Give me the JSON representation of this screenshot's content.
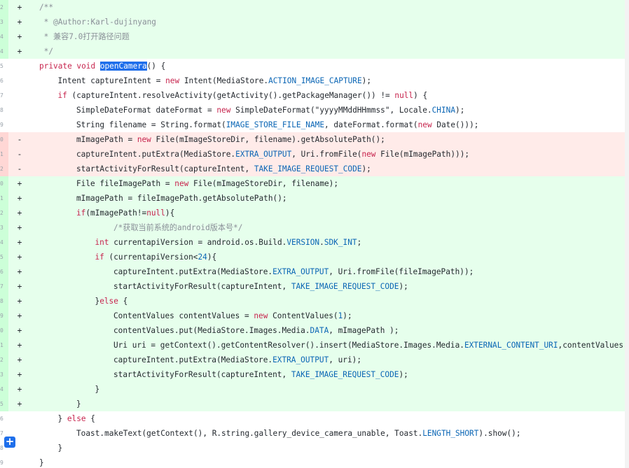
{
  "diff": {
    "add_comment_icon": "plus-icon",
    "colors": {
      "added_background": "#e6ffec",
      "removed_background": "#ffebe9",
      "keyword": "#c7254e",
      "constant": "#0b66b5",
      "comment": "#8a8f98",
      "selection": "#1f6feb"
    },
    "lines": [
      {
        "type": "add",
        "marker": "+",
        "line_no": "2",
        "indent": 0,
        "tokens": [
          {
            "t": "/**",
            "c": "com"
          }
        ]
      },
      {
        "type": "add",
        "marker": "+",
        "line_no": "3",
        "indent": 0,
        "tokens": [
          {
            "t": " * @Author:Karl-dujinyang",
            "c": "com"
          }
        ]
      },
      {
        "type": "add",
        "marker": "+",
        "line_no": "4",
        "indent": 0,
        "tokens": [
          {
            "t": " * 兼容7.0打开路径问题",
            "c": "com"
          }
        ]
      },
      {
        "type": "add",
        "marker": "+",
        "line_no": "4",
        "indent": 0,
        "tokens": [
          {
            "t": " */",
            "c": "com"
          }
        ]
      },
      {
        "type": "ctx",
        "marker": "",
        "line_no": "5",
        "indent": 0,
        "tokens": [
          {
            "t": "private void ",
            "c": "kw"
          },
          {
            "t": "openCamera",
            "c": "hl"
          },
          {
            "t": "() {",
            "c": "plain"
          }
        ]
      },
      {
        "type": "ctx",
        "marker": "",
        "line_no": "6",
        "indent": 1,
        "tokens": [
          {
            "t": "Intent captureIntent = ",
            "c": "plain"
          },
          {
            "t": "new",
            "c": "kw"
          },
          {
            "t": " Intent(MediaStore.",
            "c": "plain"
          },
          {
            "t": "ACTION_IMAGE_CAPTURE",
            "c": "const"
          },
          {
            "t": ");",
            "c": "plain"
          }
        ]
      },
      {
        "type": "ctx",
        "marker": "",
        "line_no": "7",
        "indent": 1,
        "tokens": [
          {
            "t": "if",
            "c": "kw"
          },
          {
            "t": " (captureIntent.resolveActivity(getActivity().getPackageManager()) != ",
            "c": "plain"
          },
          {
            "t": "null",
            "c": "kw"
          },
          {
            "t": ") {",
            "c": "plain"
          }
        ]
      },
      {
        "type": "ctx",
        "marker": "",
        "line_no": "8",
        "indent": 2,
        "tokens": [
          {
            "t": "SimpleDateFormat dateFormat = ",
            "c": "plain"
          },
          {
            "t": "new",
            "c": "kw"
          },
          {
            "t": " SimpleDateFormat(\"yyyyMMddHHmmss\", Locale.",
            "c": "plain"
          },
          {
            "t": "CHINA",
            "c": "const"
          },
          {
            "t": ");",
            "c": "plain"
          }
        ]
      },
      {
        "type": "ctx",
        "marker": "",
        "line_no": "9",
        "indent": 2,
        "tokens": [
          {
            "t": "String filename = String.format(",
            "c": "plain"
          },
          {
            "t": "IMAGE_STORE_FILE_NAME",
            "c": "const"
          },
          {
            "t": ", dateFormat.format(",
            "c": "plain"
          },
          {
            "t": "new",
            "c": "kw"
          },
          {
            "t": " Date()));",
            "c": "plain"
          }
        ]
      },
      {
        "type": "del",
        "marker": "-",
        "line_no": "0",
        "indent": 2,
        "tokens": [
          {
            "t": "mImagePath = ",
            "c": "plain"
          },
          {
            "t": "new",
            "c": "kw"
          },
          {
            "t": " File(mImageStoreDir, filename).getAbsolutePath();",
            "c": "plain"
          }
        ]
      },
      {
        "type": "del",
        "marker": "-",
        "line_no": "1",
        "indent": 2,
        "tokens": [
          {
            "t": "captureIntent.putExtra(MediaStore.",
            "c": "plain"
          },
          {
            "t": "EXTRA_OUTPUT",
            "c": "const"
          },
          {
            "t": ", Uri.fromFile(",
            "c": "plain"
          },
          {
            "t": "new",
            "c": "kw"
          },
          {
            "t": " File(mImagePath)));",
            "c": "plain"
          }
        ]
      },
      {
        "type": "del",
        "marker": "-",
        "line_no": "2",
        "indent": 2,
        "tokens": [
          {
            "t": "startActivityForResult(captureIntent, ",
            "c": "plain"
          },
          {
            "t": "TAKE_IMAGE_REQUEST_CODE",
            "c": "const"
          },
          {
            "t": ");",
            "c": "plain"
          }
        ]
      },
      {
        "type": "add",
        "marker": "+",
        "line_no": "0",
        "indent": 2,
        "tokens": [
          {
            "t": "File fileImagePath = ",
            "c": "plain"
          },
          {
            "t": "new",
            "c": "kw"
          },
          {
            "t": " File(mImageStoreDir, filename);",
            "c": "plain"
          }
        ]
      },
      {
        "type": "add",
        "marker": "+",
        "line_no": "1",
        "indent": 2,
        "tokens": [
          {
            "t": "mImagePath = fileImagePath.getAbsolutePath();",
            "c": "plain"
          }
        ]
      },
      {
        "type": "add",
        "marker": "+",
        "line_no": "2",
        "indent": 2,
        "tokens": [
          {
            "t": "if",
            "c": "kw"
          },
          {
            "t": "(mImagePath!=",
            "c": "plain"
          },
          {
            "t": "null",
            "c": "kw"
          },
          {
            "t": "){",
            "c": "plain"
          }
        ]
      },
      {
        "type": "add",
        "marker": "+",
        "line_no": "3",
        "indent": 4,
        "tokens": [
          {
            "t": "/*获取当前系统的android版本号*/",
            "c": "com"
          }
        ]
      },
      {
        "type": "add",
        "marker": "+",
        "line_no": "4",
        "indent": 3,
        "tokens": [
          {
            "t": "int",
            "c": "kw"
          },
          {
            "t": " currentapiVersion = android.os.Build.",
            "c": "plain"
          },
          {
            "t": "VERSION",
            "c": "const"
          },
          {
            "t": ".",
            "c": "plain"
          },
          {
            "t": "SDK_INT",
            "c": "const"
          },
          {
            "t": ";",
            "c": "plain"
          }
        ]
      },
      {
        "type": "add",
        "marker": "+",
        "line_no": "5",
        "indent": 3,
        "tokens": [
          {
            "t": "if",
            "c": "kw"
          },
          {
            "t": " (currentapiVersion<",
            "c": "plain"
          },
          {
            "t": "24",
            "c": "const"
          },
          {
            "t": "){",
            "c": "plain"
          }
        ]
      },
      {
        "type": "add",
        "marker": "+",
        "line_no": "6",
        "indent": 4,
        "tokens": [
          {
            "t": "captureIntent.putExtra(MediaStore.",
            "c": "plain"
          },
          {
            "t": "EXTRA_OUTPUT",
            "c": "const"
          },
          {
            "t": ", Uri.fromFile(fileImagePath));",
            "c": "plain"
          }
        ]
      },
      {
        "type": "add",
        "marker": "+",
        "line_no": "7",
        "indent": 4,
        "tokens": [
          {
            "t": "startActivityForResult(captureIntent, ",
            "c": "plain"
          },
          {
            "t": "TAKE_IMAGE_REQUEST_CODE",
            "c": "const"
          },
          {
            "t": ");",
            "c": "plain"
          }
        ]
      },
      {
        "type": "add",
        "marker": "+",
        "line_no": "8",
        "indent": 3,
        "tokens": [
          {
            "t": "}",
            "c": "plain"
          },
          {
            "t": "else",
            "c": "kw"
          },
          {
            "t": " {",
            "c": "plain"
          }
        ]
      },
      {
        "type": "add",
        "marker": "+",
        "line_no": "9",
        "indent": 4,
        "tokens": [
          {
            "t": "ContentValues contentValues = ",
            "c": "plain"
          },
          {
            "t": "new",
            "c": "kw"
          },
          {
            "t": " ContentValues(",
            "c": "plain"
          },
          {
            "t": "1",
            "c": "const"
          },
          {
            "t": ");",
            "c": "plain"
          }
        ]
      },
      {
        "type": "add",
        "marker": "+",
        "line_no": "0",
        "indent": 4,
        "tokens": [
          {
            "t": "contentValues.put(MediaStore.Images.Media.",
            "c": "plain"
          },
          {
            "t": "DATA",
            "c": "const"
          },
          {
            "t": ", mImagePath );",
            "c": "plain"
          }
        ]
      },
      {
        "type": "add",
        "marker": "+",
        "line_no": "1",
        "indent": 4,
        "tokens": [
          {
            "t": "Uri uri = getContext().getContentResolver().insert(MediaStore.Images.Media.",
            "c": "plain"
          },
          {
            "t": "EXTERNAL_CONTENT_URI",
            "c": "const"
          },
          {
            "t": ",contentValues);",
            "c": "plain"
          }
        ]
      },
      {
        "type": "add",
        "marker": "+",
        "line_no": "2",
        "indent": 4,
        "tokens": [
          {
            "t": "captureIntent.putExtra(MediaStore.",
            "c": "plain"
          },
          {
            "t": "EXTRA_OUTPUT",
            "c": "const"
          },
          {
            "t": ", uri);",
            "c": "plain"
          }
        ]
      },
      {
        "type": "add",
        "marker": "+",
        "line_no": "3",
        "indent": 4,
        "tokens": [
          {
            "t": "startActivityForResult(captureIntent, ",
            "c": "plain"
          },
          {
            "t": "TAKE_IMAGE_REQUEST_CODE",
            "c": "const"
          },
          {
            "t": ");",
            "c": "plain"
          }
        ]
      },
      {
        "type": "add",
        "marker": "+",
        "line_no": "4",
        "indent": 3,
        "tokens": [
          {
            "t": "}",
            "c": "plain"
          }
        ]
      },
      {
        "type": "add",
        "marker": "+",
        "line_no": "5",
        "indent": 2,
        "tokens": [
          {
            "t": "}",
            "c": "plain"
          }
        ]
      },
      {
        "type": "ctx",
        "marker": "",
        "line_no": "6",
        "indent": 1,
        "tokens": [
          {
            "t": "} ",
            "c": "plain"
          },
          {
            "t": "else",
            "c": "kw"
          },
          {
            "t": " {",
            "c": "plain"
          }
        ]
      },
      {
        "type": "ctx",
        "marker": "",
        "line_no": "7",
        "indent": 2,
        "tokens": [
          {
            "t": "Toast.makeText(getContext(), R.string.gallery_device_camera_unable, Toast.",
            "c": "plain"
          },
          {
            "t": "LENGTH_SHORT",
            "c": "const"
          },
          {
            "t": ").show();",
            "c": "plain"
          }
        ]
      },
      {
        "type": "ctx",
        "marker": "",
        "line_no": "8",
        "indent": 1,
        "tokens": [
          {
            "t": "}",
            "c": "plain"
          }
        ]
      },
      {
        "type": "ctx",
        "marker": "",
        "line_no": "9",
        "indent": 0,
        "tokens": [
          {
            "t": "}",
            "c": "plain"
          }
        ]
      }
    ]
  }
}
